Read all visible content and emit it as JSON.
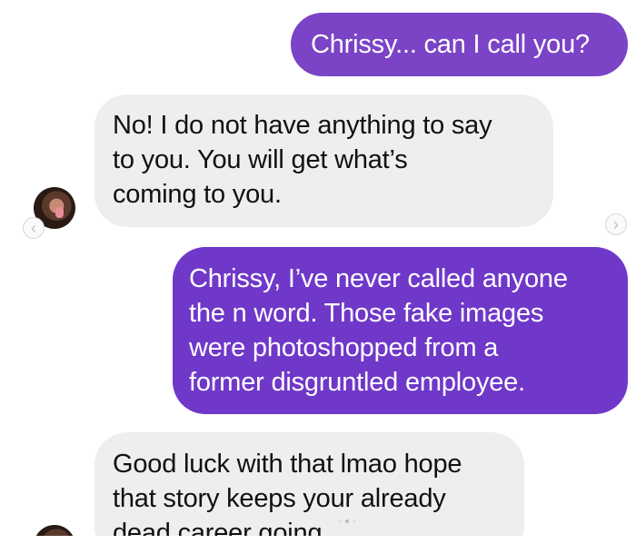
{
  "messages": [
    {
      "sender": "me",
      "lines": [
        "Chrissy... can I call you?"
      ],
      "color": "#7b43c6"
    },
    {
      "sender": "contact",
      "lines": [
        "No! I do not have anything to say",
        "to you. You will get what’s",
        "coming to you."
      ]
    },
    {
      "sender": "me",
      "lines": [
        "Chrissy, I’ve never called anyone",
        "the n word. Those fake images",
        "were photoshopped from a",
        "former disgruntled employee."
      ],
      "color": "#6f38c9"
    },
    {
      "sender": "contact",
      "lines": [
        "Good luck with that lmao hope",
        "that story keeps your already",
        "dead career going"
      ]
    }
  ],
  "carousel": {
    "prev_icon": "chevron-left-icon",
    "next_icon": "chevron-right-icon",
    "prev_glyph": "‹",
    "next_glyph": "›",
    "active_slide": 1
  },
  "colors": {
    "sent_bubble": "#7b43c6",
    "received_bubble": "#eeeeee",
    "received_text": "#111111"
  }
}
